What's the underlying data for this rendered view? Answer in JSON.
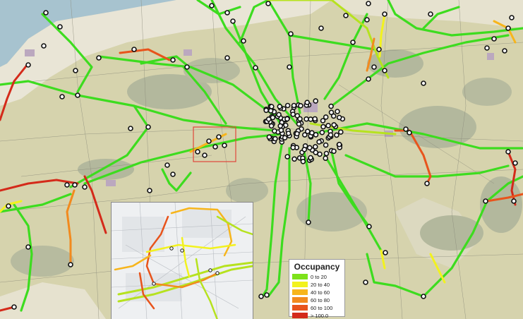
{
  "legend": {
    "title": "Occupancy",
    "items": [
      {
        "label": "0 to 20",
        "color": "#7de21a"
      },
      {
        "label": "20 to 40",
        "color": "#f2f21e"
      },
      {
        "label": "40 to 60",
        "color": "#f7b51c"
      },
      {
        "label": "60 to 80",
        "color": "#f28a1e"
      },
      {
        "label": "60 to 100",
        "color": "#e8541c"
      },
      {
        "label": "> 100.0",
        "color": "#d42a1a"
      }
    ]
  },
  "colors": {
    "land": "#d6d3ad",
    "urban": "#e9e5d6",
    "water": "#a7c3cf",
    "forest": "#b3b89d",
    "industrial": "#bba8bf",
    "route_free": "#3ddc1f",
    "node_fill": "#ffffff",
    "node_stroke": "#111111",
    "highlight_box": "#e0453a",
    "inset_bg": "#eef0f2"
  },
  "map": {
    "highlighted_area": "zoom-region",
    "inset": "zoomed-town-detail"
  }
}
